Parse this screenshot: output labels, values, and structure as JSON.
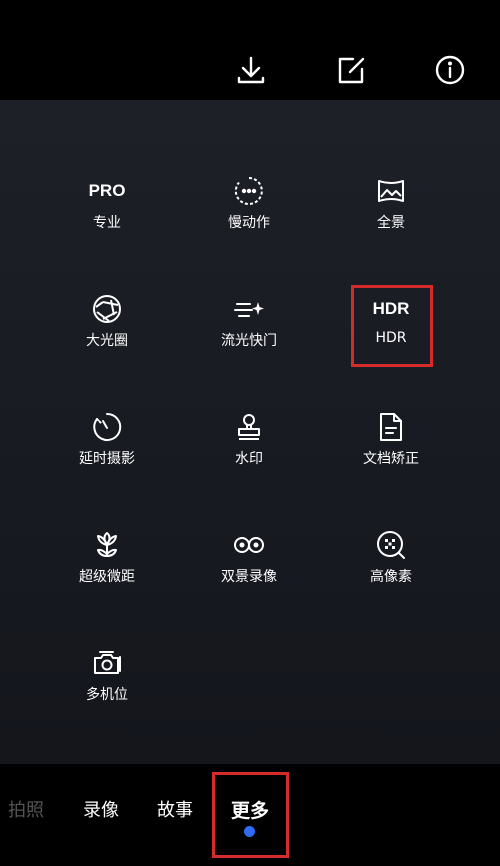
{
  "top_actions": [
    {
      "name": "download-icon"
    },
    {
      "name": "edit-icon"
    },
    {
      "name": "info-icon"
    }
  ],
  "modes": [
    {
      "icon_text": "PRO",
      "label": "专业"
    },
    {
      "icon": "slow-motion-icon",
      "label": "慢动作"
    },
    {
      "icon": "panorama-icon",
      "label": "全景"
    },
    {
      "icon": "aperture-icon",
      "label": "大光圈"
    },
    {
      "icon": "light-trail-icon",
      "label": "流光快门"
    },
    {
      "icon_text": "HDR",
      "label": "HDR"
    },
    {
      "icon": "timer-icon",
      "label": "延时摄影"
    },
    {
      "icon": "stamp-icon",
      "label": "水印"
    },
    {
      "icon": "document-icon",
      "label": "文档矫正"
    },
    {
      "icon": "flower-icon",
      "label": "超级微距"
    },
    {
      "icon": "dual-view-icon",
      "label": "双景录像"
    },
    {
      "icon": "high-res-icon",
      "label": "高像素"
    },
    {
      "icon": "multi-camera-icon",
      "label": "多机位"
    }
  ],
  "bottom_tabs": [
    {
      "label": "拍照"
    },
    {
      "label": "录像"
    },
    {
      "label": "故事"
    },
    {
      "label": "更多",
      "active": true
    }
  ],
  "colors": {
    "highlight": "#d62b2b",
    "active_dot": "#2f6bf5"
  }
}
